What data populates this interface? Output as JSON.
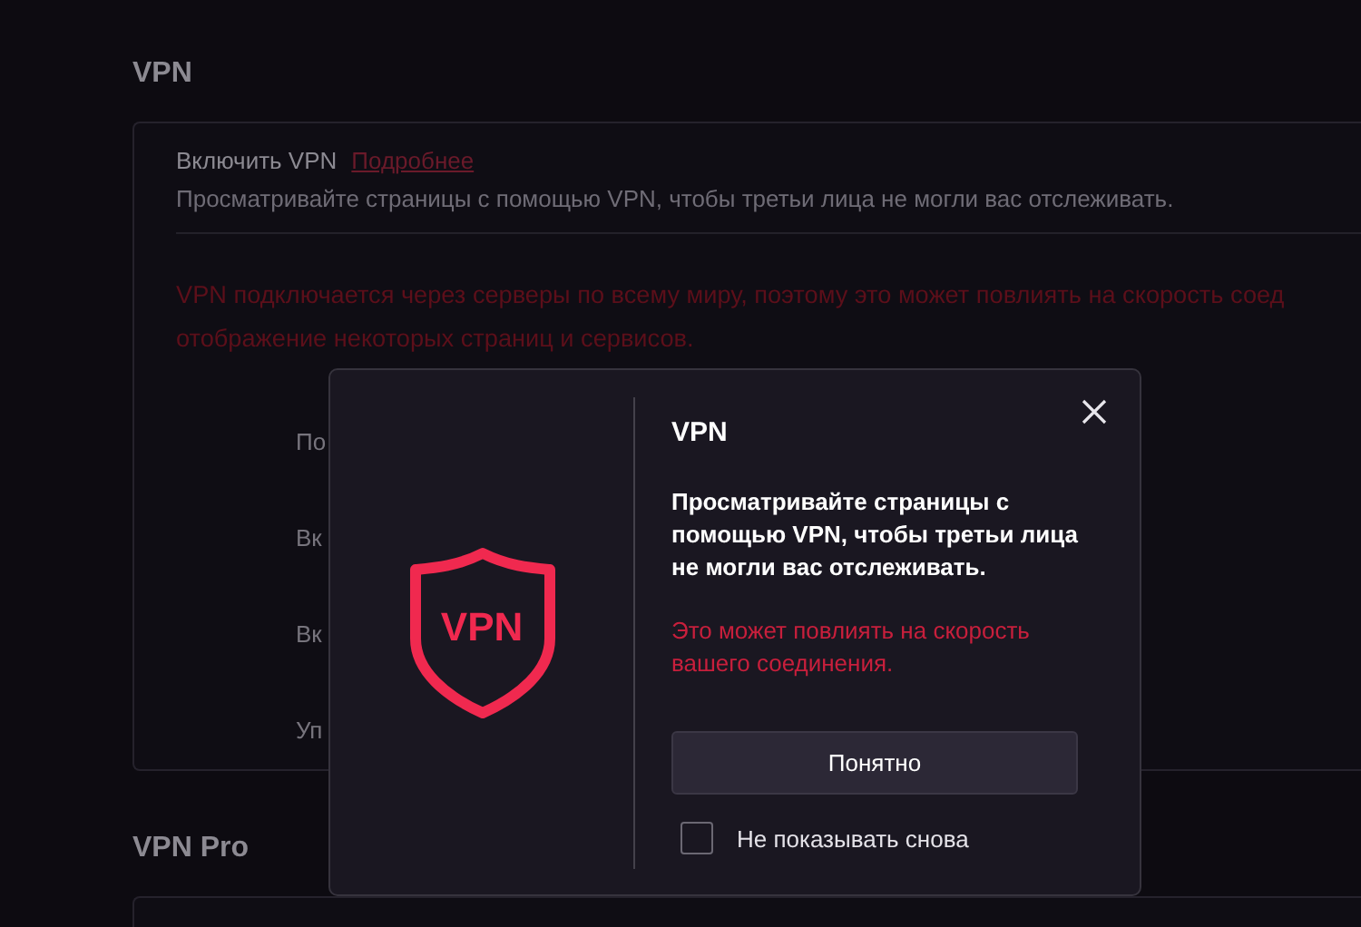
{
  "page": {
    "sections": [
      {
        "heading": "VPN",
        "title": "Включить VPN",
        "link": "Подробнее",
        "description": "Просматривайте страницы с помощью VPN, чтобы третьи лица не могли вас отслеживать.",
        "warning": [
          "VPN подключается через серверы по всему миру, поэтому это может повлиять на скорость соед",
          "отображение некоторых страниц и сервисов."
        ],
        "rows": [
          "По",
          "Вк",
          "Вк",
          "Уп"
        ]
      },
      {
        "heading": "VPN Pro"
      }
    ]
  },
  "dialog": {
    "logo_text": "VPN",
    "title": "VPN",
    "description": "Просматривайте страницы с помощью VPN, чтобы третьи лица не могли вас отслеживать.",
    "warning": "Это может повлиять на скорость вашего соединения.",
    "button": "Понятно",
    "checkbox": {
      "label": "Не показывать снова",
      "checked": false
    }
  }
}
